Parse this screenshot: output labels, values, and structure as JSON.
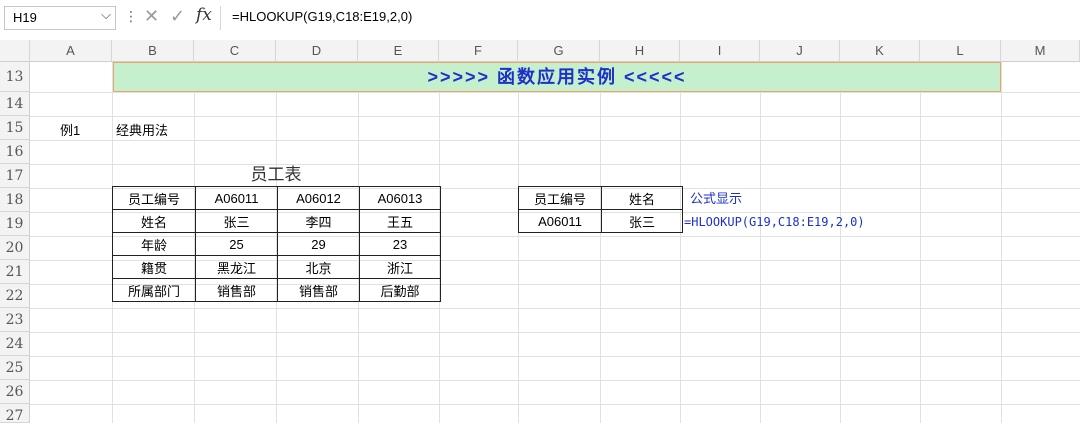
{
  "formula_bar": {
    "name_box": "H19",
    "formula": "=HLOOKUP(G19,C18:E19,2,0)",
    "fx_label": "fx"
  },
  "columns": [
    "A",
    "B",
    "C",
    "D",
    "E",
    "F",
    "G",
    "H",
    "I",
    "J",
    "K",
    "L",
    "M"
  ],
  "rows": [
    "13",
    "14",
    "15",
    "16",
    "17",
    "18",
    "19",
    "20",
    "21",
    "22",
    "23",
    "24",
    "25",
    "26",
    "27"
  ],
  "banner": ">>>>>   函数应用实例   <<<<<",
  "example": {
    "label": "例1",
    "title": "经典用法"
  },
  "employee_table": {
    "title": "员工表",
    "rows": [
      [
        "员工编号",
        "A06011",
        "A06012",
        "A06013"
      ],
      [
        "姓名",
        "张三",
        "李四",
        "王五"
      ],
      [
        "年龄",
        "25",
        "29",
        "23"
      ],
      [
        "籍贯",
        "黑龙江",
        "北京",
        "浙江"
      ],
      [
        "所属部门",
        "销售部",
        "销售部",
        "后勤部"
      ]
    ]
  },
  "lookup_table": {
    "headers": [
      "员工编号",
      "姓名"
    ],
    "row": [
      "A06011",
      "张三"
    ]
  },
  "formula_label": "公式显示",
  "formula_display": "=HLOOKUP(G19,C18:E19,2,0)"
}
